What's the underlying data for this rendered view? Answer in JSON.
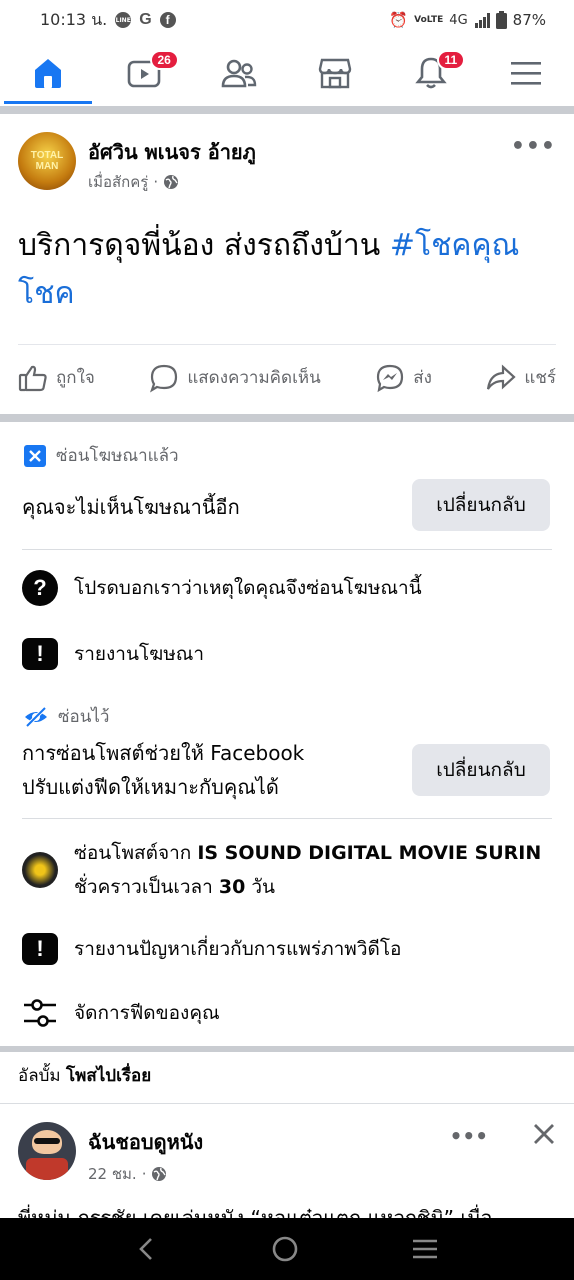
{
  "status_bar": {
    "time": "10:13 น.",
    "app_icons": [
      "line-icon",
      "google-icon",
      "facebook-icon"
    ],
    "network": "4G",
    "volte": "VoLTE",
    "battery": "87%"
  },
  "nav": {
    "tabs": [
      {
        "name": "home",
        "badge": ""
      },
      {
        "name": "watch",
        "badge": "26"
      },
      {
        "name": "friends",
        "badge": ""
      },
      {
        "name": "marketplace",
        "badge": ""
      },
      {
        "name": "notifications",
        "badge": "11"
      },
      {
        "name": "menu",
        "badge": ""
      }
    ],
    "active_tab": "home",
    "accent": "#1877f2"
  },
  "post": {
    "author": "อัศวิน พเนจร อ้ายภู",
    "avatar_text": "TOTAL MAN",
    "time": "เมื่อสักครู่",
    "privacy_icon": "globe-icon",
    "text": "บริการดุจพี่น้อง ส่งรถถึงบ้าน ",
    "hashtag": "#โชคคุณโชค"
  },
  "actions": {
    "like": "ถูกใจ",
    "comment": "แสดงความคิดเห็น",
    "send": "ส่ง",
    "share": "แชร์"
  },
  "ad_hidden": {
    "label": "ซ่อนโฆษณาแล้ว",
    "message": "คุณจะไม่เห็นโฆษณานี้อีก",
    "undo": "เปลี่ยนกลับ",
    "why": "โปรดบอกเราว่าเหตุใดคุณจึงซ่อนโฆษณานี้",
    "report": "รายงานโฆษณา"
  },
  "post_hidden": {
    "label": "ซ่อนไว้",
    "message_line1": "การซ่อนโพสต์ช่วยให้ Facebook",
    "message_line2": "ปรับแต่งฟีดให้เหมาะกับคุณได้",
    "undo": "เปลี่ยนกลับ",
    "snooze_prefix": "ซ่อนโพสต์จาก ",
    "snooze_page": "IS SOUND DIGITAL MOVIE SURIN",
    "snooze_line2_prefix": "ชั่วคราวเป็นเวลา ",
    "snooze_days": "30",
    "snooze_unit": " วัน",
    "report_video": "รายงานปัญหาเกี่ยวกับการแพร่ภาพวิดีโอ",
    "manage_feed": "จัดการฟีดของคุณ"
  },
  "album": {
    "prefix": "อัลบั้ม ",
    "title": "โพสไปเรื่อย"
  },
  "post2": {
    "author": "ฉันชอบดูหนัง",
    "time": "22 ชม.",
    "preview": "พี่หม่น กรรชัย เคยเล่นหนัง “หอแต๋วแตก แหวกชิมิ” เมื่อ"
  }
}
